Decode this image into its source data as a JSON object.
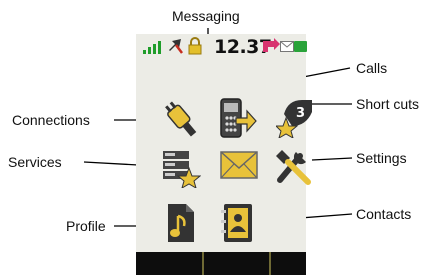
{
  "callouts": {
    "messaging": "Messaging",
    "calls": "Calls",
    "connections": "Connections",
    "short_cuts": "Short cuts",
    "services": "Services",
    "settings": "Settings",
    "profile": "Profile",
    "contacts": "Contacts"
  },
  "status_bar": {
    "time": "12.37",
    "icons": [
      "signal-bars-icon",
      "missed-call-icon",
      "keypad-lock-icon",
      "message-waiting-icon",
      "envelope-icon",
      "battery-icon"
    ],
    "colors": {
      "signal": "#1f9d2a",
      "missed_call": "#c62d1f",
      "lock": "#d8b21c",
      "message": "#d8336f",
      "battery": "#2aa33a"
    }
  },
  "menu_icons": [
    "connections-icon",
    "calls-icon",
    "short-cuts-icon",
    "services-icon",
    "messaging-icon",
    "settings-icon",
    "profile-icon",
    "contacts-icon"
  ],
  "colors": {
    "screen_background": "#ecece6",
    "icon_gold": "#e8c23a",
    "icon_dark": "#2a2a2a",
    "softkey_bar": "#0d0d0d"
  }
}
